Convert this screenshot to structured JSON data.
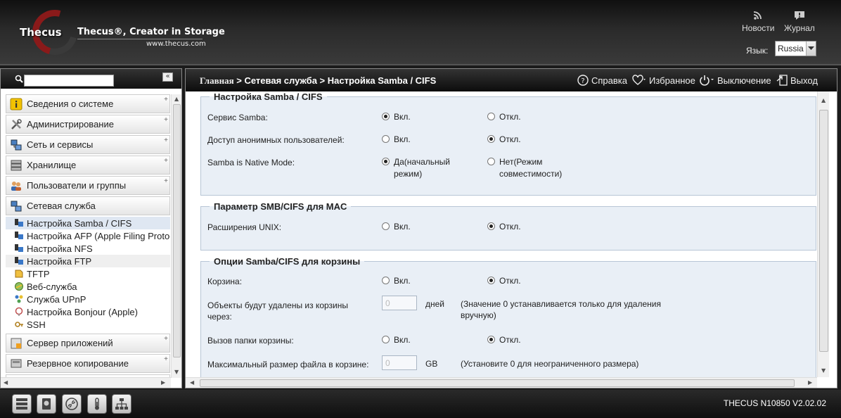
{
  "header": {
    "logo_word": "Thecus",
    "logo_tagline": "Thecus®, Creator in Storage",
    "logo_url": "www.thecus.com",
    "news_label": "Новости",
    "journal_label": "Журнал",
    "language_label": "Язык:",
    "language_value": "Russia"
  },
  "sidebar": {
    "search_placeholder": "",
    "categories_top": [
      {
        "label": "Сведения о системе",
        "icon": "info-icon"
      },
      {
        "label": "Администрирование",
        "icon": "tools-icon"
      },
      {
        "label": "Сеть и сервисы",
        "icon": "network-icon"
      },
      {
        "label": "Хранилище",
        "icon": "storage-icon"
      },
      {
        "label": "Пользователи и группы",
        "icon": "users-icon"
      },
      {
        "label": "Сетевая служба",
        "icon": "network-service-icon"
      }
    ],
    "subitems": [
      {
        "label": "Настройка Samba / CIFS",
        "icon": "samba-icon"
      },
      {
        "label": "Настройка AFP (Apple Filing Protocol)",
        "icon": "afp-icon"
      },
      {
        "label": "Настройка NFS",
        "icon": "nfs-icon"
      },
      {
        "label": "Настройка FTP",
        "icon": "ftp-icon"
      },
      {
        "label": "TFTP",
        "icon": "tftp-icon"
      },
      {
        "label": "Веб-служба",
        "icon": "web-icon"
      },
      {
        "label": "Служба UPnP",
        "icon": "upnp-icon"
      },
      {
        "label": "Настройка Bonjour (Apple)",
        "icon": "bonjour-icon"
      },
      {
        "label": "SSH",
        "icon": "ssh-icon"
      }
    ],
    "categories_bottom": [
      {
        "label": "Сервер приложений",
        "icon": "app-server-icon"
      },
      {
        "label": "Резервное копирование",
        "icon": "backup-icon"
      }
    ]
  },
  "topbar": {
    "breadcrumb_home": "Главная",
    "breadcrumb_rest": " > Сетевая служба > Настройка Samba / CIFS",
    "help_label": "Справка",
    "favorites_label": "Избранное",
    "shutdown_label": "Выключение",
    "logout_label": "Выход"
  },
  "form": {
    "group1": {
      "title": "Настройка Samba / CIFS",
      "samba_service_label": "Сервис Samba:",
      "anon_access_label": "Доступ анонимных пользователей:",
      "native_mode_label": "Samba is Native Mode:",
      "on": "Вкл.",
      "off": "Откл.",
      "native_yes": "Да(начальный режим)",
      "native_no": "Нет(Режим совместимости)"
    },
    "group2": {
      "title": "Параметр SMB/CIFS для MAC",
      "unix_ext_label": "Расширения UNIX:",
      "on": "Вкл.",
      "off": "Откл."
    },
    "group3": {
      "title": "Опции Samba/CIFS для корзины",
      "recycle_label": "Корзина:",
      "delete_after_label": "Объекты будут удалены из корзины через:",
      "days_value": "0",
      "days_unit": "дней",
      "days_note": "(Значение 0 устанавливается только для удаления вручную)",
      "recycle_folder_label": "Вызов папки корзины:",
      "max_size_label": "Максимальный размер файла в корзине:",
      "size_value": "0",
      "size_unit": "GB",
      "size_note": "(Установите 0 для неограниченного размера)",
      "on": "Вкл.",
      "off": "Откл."
    }
  },
  "footer": {
    "version": "THECUS N10850 V2.02.02"
  }
}
